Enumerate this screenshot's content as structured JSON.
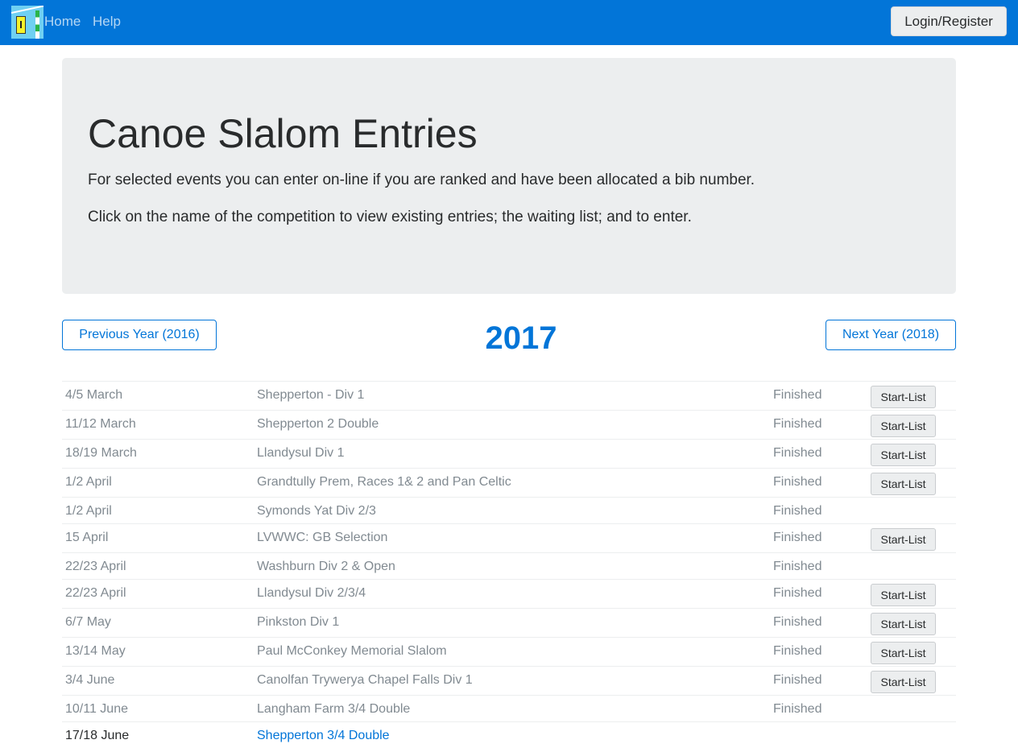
{
  "navbar": {
    "home_label": "Home",
    "help_label": "Help",
    "login_label": "Login/Register",
    "brand_color": "#0275d8"
  },
  "jumbotron": {
    "title": "Canoe Slalom Entries",
    "paragraph1": "For selected events you can enter on-line if you are ranked and have been allocated a bib number.",
    "paragraph2": "Click on the name of the competition to view existing entries; the waiting list; and to enter."
  },
  "year_nav": {
    "previous_label": "Previous Year (2016)",
    "current_year": "2017",
    "next_label": "Next Year (2018)"
  },
  "events": [
    {
      "date": "4/5 March",
      "name": "Shepperton - Div 1",
      "status": "Finished",
      "button": "Start-List"
    },
    {
      "date": "11/12 March",
      "name": "Shepperton 2 Double",
      "status": "Finished",
      "button": "Start-List"
    },
    {
      "date": "18/19 March",
      "name": "Llandysul Div 1",
      "status": "Finished",
      "button": "Start-List"
    },
    {
      "date": "1/2 April",
      "name": "Grandtully Prem, Races 1& 2 and Pan Celtic",
      "status": "Finished",
      "button": "Start-List"
    },
    {
      "date": "1/2 April",
      "name": "Symonds Yat Div 2/3",
      "status": "Finished",
      "button": ""
    },
    {
      "date": "15 April",
      "name": "LVWWC: GB Selection",
      "status": "Finished",
      "button": "Start-List"
    },
    {
      "date": "22/23 April",
      "name": "Washburn Div 2 & Open",
      "status": "Finished",
      "button": ""
    },
    {
      "date": "22/23 April",
      "name": "Llandysul Div 2/3/4",
      "status": "Finished",
      "button": "Start-List"
    },
    {
      "date": "6/7 May",
      "name": "Pinkston Div 1",
      "status": "Finished",
      "button": "Start-List"
    },
    {
      "date": "13/14 May",
      "name": "Paul McConkey Memorial Slalom",
      "status": "Finished",
      "button": "Start-List"
    },
    {
      "date": "3/4 June",
      "name": "Canolfan Trywerya Chapel Falls Div 1",
      "status": "Finished",
      "button": "Start-List"
    },
    {
      "date": "10/11 June",
      "name": "Langham Farm 3/4 Double",
      "status": "Finished",
      "button": ""
    },
    {
      "date": "17/18 June",
      "name": "Shepperton 3/4 Double",
      "status": "",
      "button": ""
    }
  ]
}
